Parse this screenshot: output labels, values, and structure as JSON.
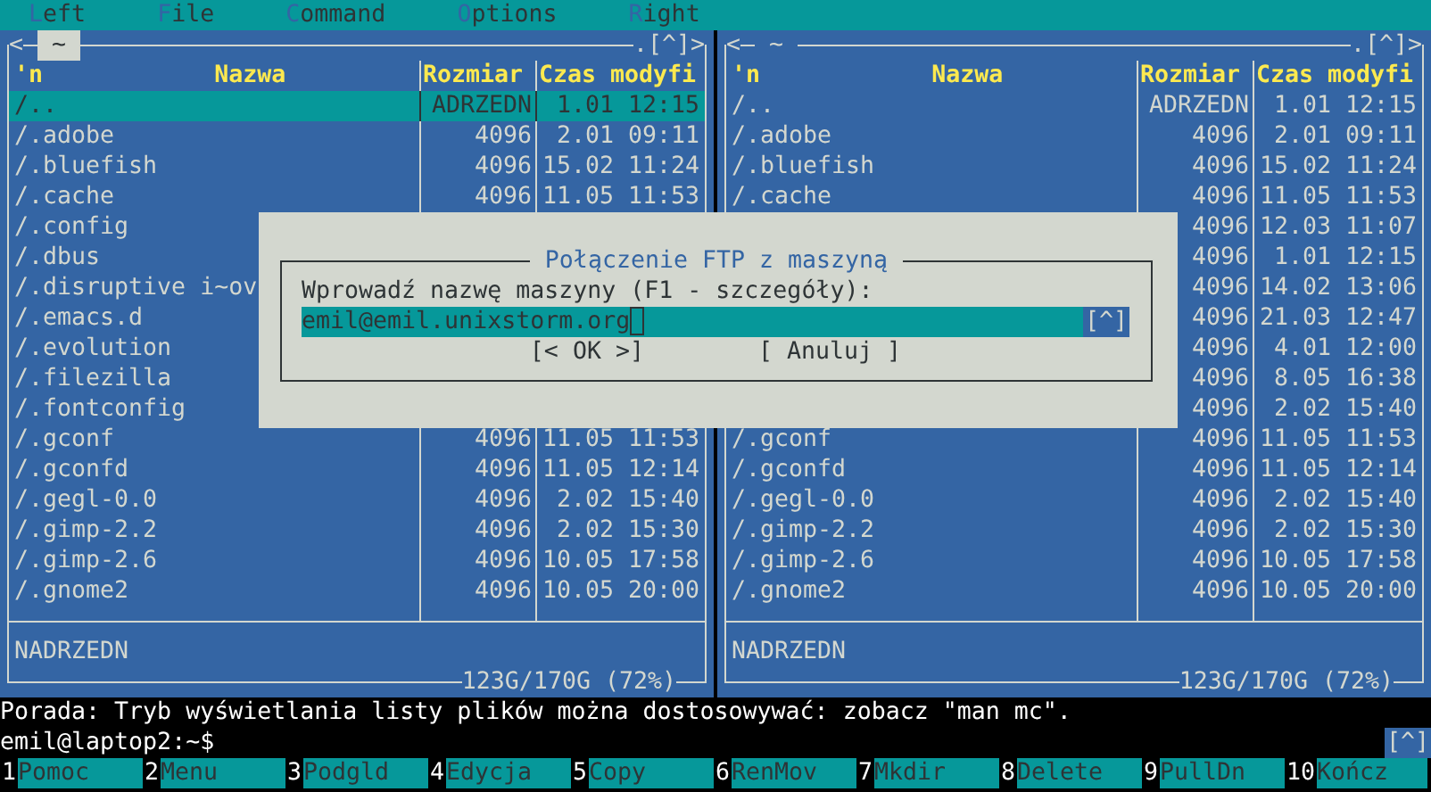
{
  "menu": [
    "Left",
    "File",
    "Command",
    "Options",
    "Right"
  ],
  "panels": [
    {
      "active": true,
      "top_left": "<",
      "path": "~",
      "top_right": ".[^]>",
      "columns": [
        "'n",
        "Nazwa",
        "Rozmiar",
        "Czas modyfi"
      ],
      "status": "NADRZEDN",
      "disk": "123G/170G (72%)",
      "rows": [
        {
          "name": "/..",
          "size": "ADRZEDN",
          "time": "1.01 12:15",
          "selected": true
        },
        {
          "name": "/.adobe",
          "size": "4096",
          "time": "2.01 09:11",
          "selected": false
        },
        {
          "name": "/.bluefish",
          "size": "4096",
          "time": "15.02 11:24",
          "selected": false
        },
        {
          "name": "/.cache",
          "size": "4096",
          "time": "11.05 11:53",
          "selected": false
        },
        {
          "name": "/.config",
          "selected": false
        },
        {
          "name": "/.dbus",
          "selected": false
        },
        {
          "name": "/.disruptive i~ov",
          "selected": false
        },
        {
          "name": "/.emacs.d",
          "selected": false
        },
        {
          "name": "/.evolution",
          "selected": false
        },
        {
          "name": "/.filezilla",
          "selected": false
        },
        {
          "name": "/.fontconfig",
          "selected": false
        },
        {
          "name": "/.gconf",
          "size": "4096",
          "time": "11.05 11:53",
          "selected": false
        },
        {
          "name": "/.gconfd",
          "size": "4096",
          "time": "11.05 12:14",
          "selected": false
        },
        {
          "name": "/.gegl-0.0",
          "size": "4096",
          "time": "2.02 15:40",
          "selected": false
        },
        {
          "name": "/.gimp-2.2",
          "size": "4096",
          "time": "2.02 15:30",
          "selected": false
        },
        {
          "name": "/.gimp-2.6",
          "size": "4096",
          "time": "10.05 17:58",
          "selected": false
        },
        {
          "name": "/.gnome2",
          "size": "4096",
          "time": "10.05 20:00",
          "selected": false
        }
      ]
    },
    {
      "active": false,
      "top_left": "<",
      "path": "~",
      "top_right": ".[^]>",
      "columns": [
        "'n",
        "Nazwa",
        "Rozmiar",
        "Czas modyfi"
      ],
      "status": "NADRZEDN",
      "disk": "123G/170G (72%)",
      "rows": [
        {
          "name": "/..",
          "size": "ADRZEDN",
          "time": "1.01 12:15",
          "selected": false
        },
        {
          "name": "/.adobe",
          "size": "4096",
          "time": "2.01 09:11",
          "selected": false
        },
        {
          "name": "/.bluefish",
          "size": "4096",
          "time": "15.02 11:24",
          "selected": false
        },
        {
          "name": "/.cache",
          "size": "4096",
          "time": "11.05 11:53",
          "selected": false
        },
        {
          "size": "4096",
          "time": "12.03 11:07",
          "selected": false
        },
        {
          "size": "4096",
          "time": "1.01 12:15",
          "selected": false
        },
        {
          "size": "4096",
          "time": "14.02 13:06",
          "selected": false
        },
        {
          "size": "4096",
          "time": "21.03 12:47",
          "selected": false
        },
        {
          "size": "4096",
          "time": "4.01 12:00",
          "selected": false
        },
        {
          "size": "4096",
          "time": "8.05 16:38",
          "selected": false
        },
        {
          "size": "4096",
          "time": "2.02 15:40",
          "selected": false
        },
        {
          "name": "/.gconf",
          "size": "4096",
          "time": "11.05 11:53",
          "selected": false
        },
        {
          "name": "/.gconfd",
          "size": "4096",
          "time": "11.05 12:14",
          "selected": false
        },
        {
          "name": "/.gegl-0.0",
          "size": "4096",
          "time": "2.02 15:40",
          "selected": false
        },
        {
          "name": "/.gimp-2.2",
          "size": "4096",
          "time": "2.02 15:30",
          "selected": false
        },
        {
          "name": "/.gimp-2.6",
          "size": "4096",
          "time": "10.05 17:58",
          "selected": false
        },
        {
          "name": "/.gnome2",
          "size": "4096",
          "time": "10.05 20:00",
          "selected": false
        }
      ]
    }
  ],
  "dialog": {
    "title": "Połączenie FTP z maszyną",
    "label": "Wprowadź nazwę maszyny (F1 - szczegóły):",
    "value": "emil@emil.unixstorm.org",
    "history": "[^]",
    "buttons": [
      "[< OK >]",
      "[ Anuluj ]"
    ]
  },
  "hint": "Porada: Tryb wyświetlania listy plików można dostosowywać: zobacz \"man mc\".",
  "prompt": {
    "text": "emil@laptop2:~$",
    "history": "[^]"
  },
  "function_keys": [
    {
      "key": "1",
      "label": "Pomoc"
    },
    {
      "key": "2",
      "label": "Menu"
    },
    {
      "key": "3",
      "label": "Podgld"
    },
    {
      "key": "4",
      "label": "Edycja"
    },
    {
      "key": "5",
      "label": "Copy"
    },
    {
      "key": "6",
      "label": "RenMov"
    },
    {
      "key": "7",
      "label": "Mkdir"
    },
    {
      "key": "8",
      "label": "Delete"
    },
    {
      "key": "9",
      "label": "PullDn"
    },
    {
      "key": "10",
      "label": "Kończ"
    }
  ]
}
